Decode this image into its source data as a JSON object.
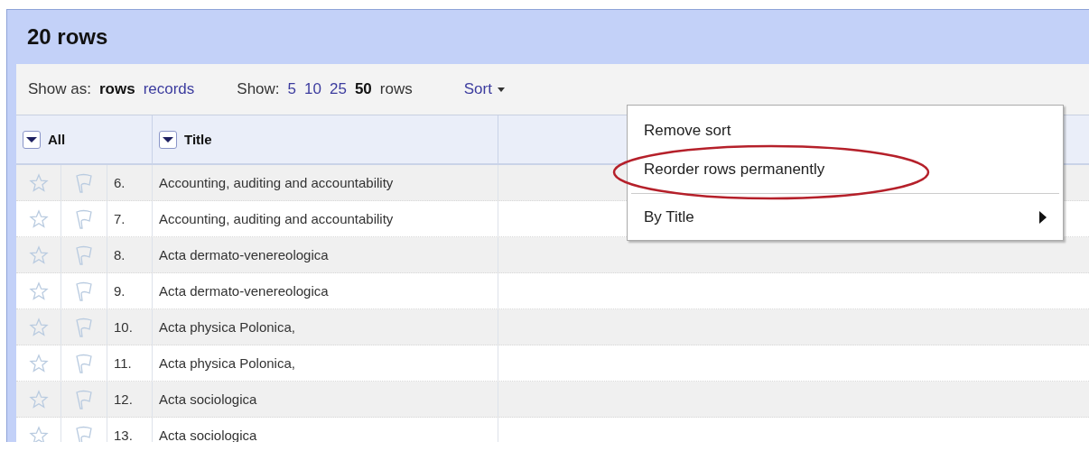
{
  "title": "20 rows",
  "toolbar": {
    "show_as_label": "Show as:",
    "show_as": [
      {
        "label": "rows",
        "selected": true
      },
      {
        "label": "records",
        "selected": false
      }
    ],
    "show_label": "Show:",
    "page_sizes": [
      {
        "label": "5",
        "selected": false
      },
      {
        "label": "10",
        "selected": false
      },
      {
        "label": "25",
        "selected": false
      },
      {
        "label": "50",
        "selected": true
      }
    ],
    "page_size_unit": "rows",
    "sort_label": "Sort"
  },
  "columns": [
    {
      "label": "All"
    },
    {
      "label": "Title"
    }
  ],
  "rows": [
    {
      "number": "6.",
      "title": "Accounting, auditing and accountability",
      "starred": false,
      "flagged": false
    },
    {
      "number": "7.",
      "title": "Accounting, auditing and accountability",
      "starred": false,
      "flagged": false
    },
    {
      "number": "8.",
      "title": "Acta dermato-venereologica",
      "starred": false,
      "flagged": false
    },
    {
      "number": "9.",
      "title": "Acta dermato-venereologica",
      "starred": false,
      "flagged": false
    },
    {
      "number": "10.",
      "title": "Acta physica Polonica,",
      "starred": false,
      "flagged": false
    },
    {
      "number": "11.",
      "title": "Acta physica Polonica,",
      "starred": false,
      "flagged": false
    },
    {
      "number": "12.",
      "title": "Acta sociologica",
      "starred": false,
      "flagged": false
    },
    {
      "number": "13.",
      "title": "Acta sociologica",
      "starred": false,
      "flagged": false
    }
  ],
  "sort_menu": {
    "items": [
      {
        "kind": "item",
        "label": "Remove sort",
        "highlighted": false
      },
      {
        "kind": "item",
        "label": "Reorder rows permanently",
        "highlighted": true
      },
      {
        "kind": "separator"
      },
      {
        "kind": "submenu",
        "label": "By Title",
        "highlighted": false
      }
    ]
  }
}
